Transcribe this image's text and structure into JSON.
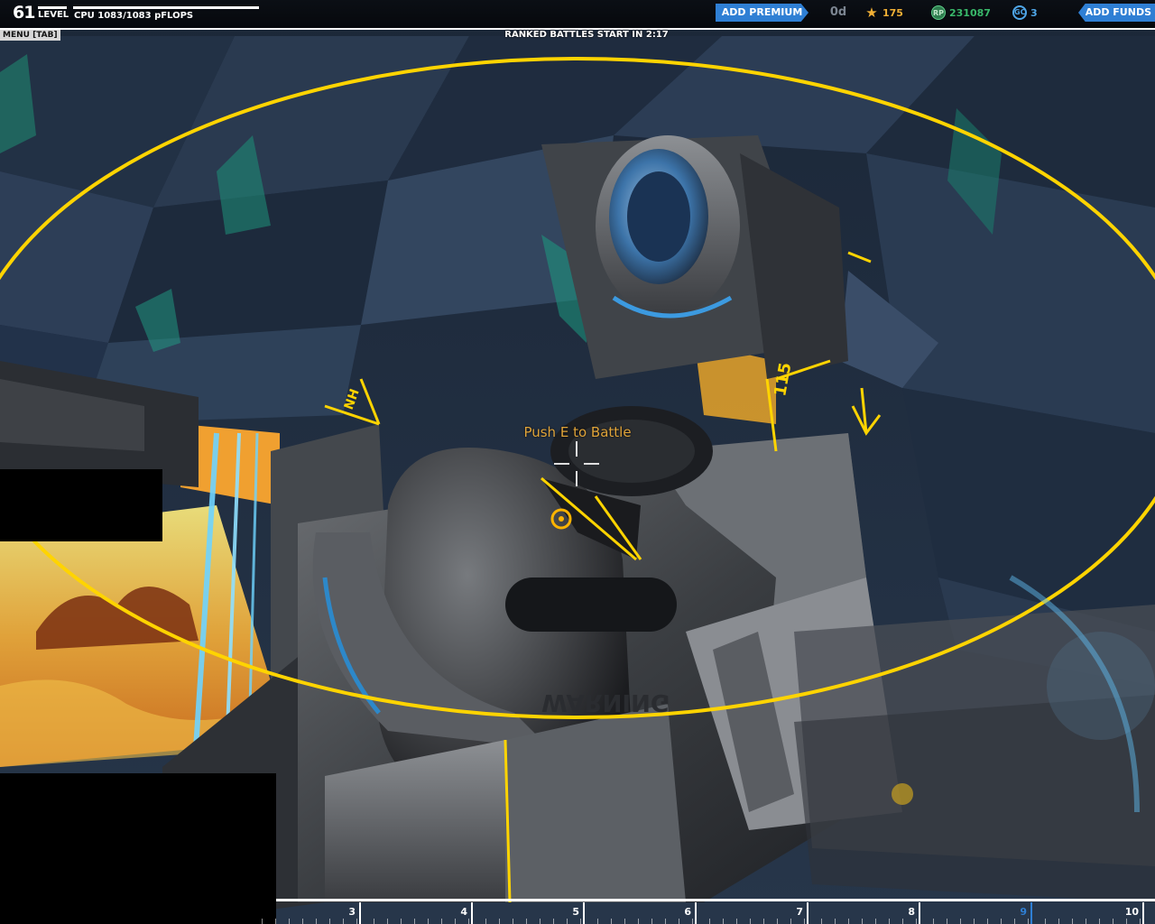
{
  "hud": {
    "level": "61",
    "level_label": "LEVEL",
    "cpu_text": "CPU 1083/1083 pFLOPS",
    "cpu_fill_fraction": 1.0,
    "add_premium_label": "ADD PREMIUM",
    "premium_days": "0d",
    "robot_points": "175",
    "robits": "231087",
    "galaxy_credits": "3",
    "add_funds_label": "ADD FUNDS",
    "menu_label": "MENU [TAB]",
    "ranked_text": "RANKED BATTLES START IN  2:17",
    "battle_prompt": "Push E to Battle"
  },
  "hotbar": {
    "slots": [
      {
        "num": "3",
        "selected": false
      },
      {
        "num": "4",
        "selected": false
      },
      {
        "num": "5",
        "selected": false
      },
      {
        "num": "6",
        "selected": false
      },
      {
        "num": "7",
        "selected": false
      },
      {
        "num": "8",
        "selected": false
      },
      {
        "num": "9",
        "selected": true
      },
      {
        "num": "10",
        "selected": false
      }
    ]
  },
  "colors": {
    "accent": "#2f7fd4",
    "hologram": "#ffd400",
    "robot_points": "#f2b035",
    "robits": "#39b86a",
    "galaxy_credits": "#4fa6e8"
  }
}
